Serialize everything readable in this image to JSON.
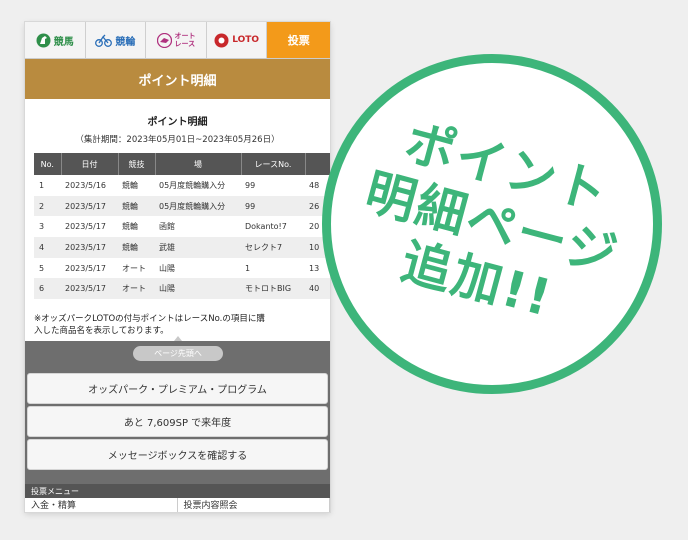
{
  "tabs": [
    {
      "label": "競馬",
      "icon": "horse-icon"
    },
    {
      "label": "競輪",
      "icon": "bicycle-icon"
    },
    {
      "label_line1": "オート",
      "label_line2": "レース",
      "icon": "motorcycle-icon"
    },
    {
      "label": "LOTO",
      "icon": "loto-icon"
    },
    {
      "label": "投票"
    }
  ],
  "page_title": "ポイント明細",
  "section_title": "ポイント明細",
  "period": "（集計期間：2023年05月01日~2023年05月26日）",
  "table": {
    "headers": [
      "No.",
      "日付",
      "競技",
      "場",
      "レースNo.",
      ""
    ],
    "rows": [
      [
        "1",
        "2023/5/16",
        "競輪",
        "05月度競輪購入分",
        "99",
        "48"
      ],
      [
        "2",
        "2023/5/17",
        "競輪",
        "05月度競輪購入分",
        "99",
        "26"
      ],
      [
        "3",
        "2023/5/17",
        "競輪",
        "函館",
        "Dokanto!7",
        "20"
      ],
      [
        "4",
        "2023/5/17",
        "競輪",
        "武雄",
        "セレクト7",
        "10"
      ],
      [
        "5",
        "2023/5/17",
        "オート",
        "山陽",
        "1",
        "13"
      ],
      [
        "6",
        "2023/5/17",
        "オート",
        "山陽",
        "モトロトBIG",
        "40"
      ]
    ]
  },
  "note_line1": "※オッズパークLOTOの付与ポイントはレースNo.の項目に購",
  "note_line2": "入した商品名を表示しております。",
  "to_top": "ページ先頭へ",
  "buttons": {
    "premium": "オッズパーク・プレミアム・プログラム",
    "next_year": "あと 7,609SP で来年度",
    "messagebox": "メッセージボックスを確認する"
  },
  "menu": {
    "label": "投票メニュー",
    "items": [
      "入金・精算",
      "投票内容照会"
    ]
  },
  "stamp": {
    "line1": "ポイント",
    "line2": "明細ページ",
    "line3": "追加!!"
  },
  "colors": {
    "accent_gold": "#b98b3f",
    "vote_orange": "#f39a1a",
    "stamp_green": "#3db57a"
  }
}
